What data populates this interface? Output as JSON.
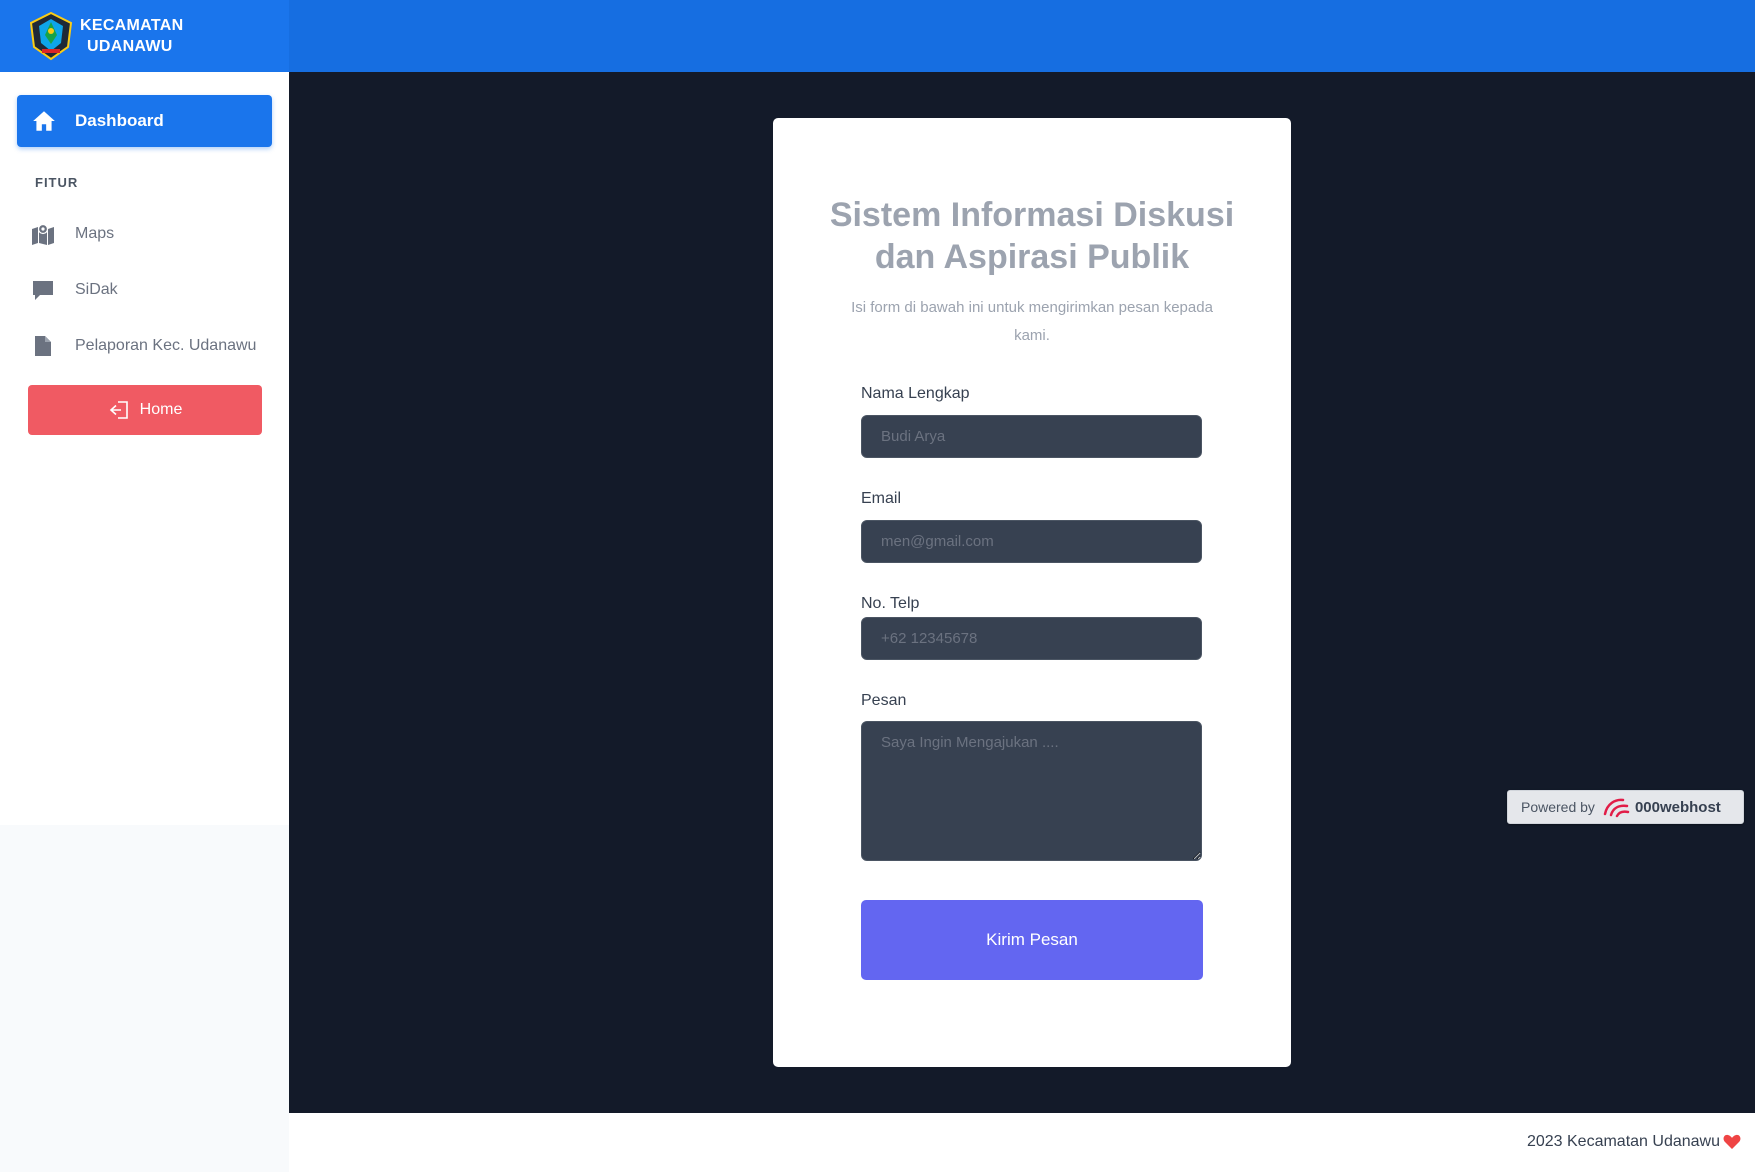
{
  "brand": {
    "line1": "KECAMATAN",
    "line2": "UDANAWU",
    "logo_icon": "kecamatan-emblem-icon"
  },
  "sidebar": {
    "dashboard_label": "Dashboard",
    "section_title": "FITUR",
    "items": [
      {
        "label": "Maps",
        "icon": "map-icon"
      },
      {
        "label": "SiDak",
        "icon": "chat-icon"
      },
      {
        "label": "Pelaporan Kec. Udanawu",
        "icon": "file-icon"
      }
    ],
    "home_label": "Home"
  },
  "form": {
    "title_line1": "Sistem Informasi Diskusi",
    "title_line2": "dan Aspirasi Publik",
    "subtitle": "Isi form di bawah ini untuk mengirimkan pesan kepada kami.",
    "fields": {
      "name": {
        "label": "Nama Lengkap",
        "placeholder": "Budi Arya",
        "value": ""
      },
      "email": {
        "label": "Email",
        "placeholder": "men@gmail.com",
        "value": ""
      },
      "phone": {
        "label": "No. Telp",
        "placeholder": "+62 12345678",
        "value": ""
      },
      "message": {
        "label": "Pesan",
        "placeholder": "Saya Ingin Mengajukan ....",
        "value": ""
      }
    },
    "submit_label": "Kirim Pesan"
  },
  "badge": {
    "powered_by": "Powered by",
    "host_name": "000webhost"
  },
  "footer": {
    "text": "2023 Kecamatan Udanawu"
  },
  "colors": {
    "topbar": "#166ee1",
    "primary": "#1a75ec",
    "danger": "#f05a63",
    "main_bg": "#131a29",
    "submit": "#6366f1",
    "input_bg": "#374151"
  }
}
